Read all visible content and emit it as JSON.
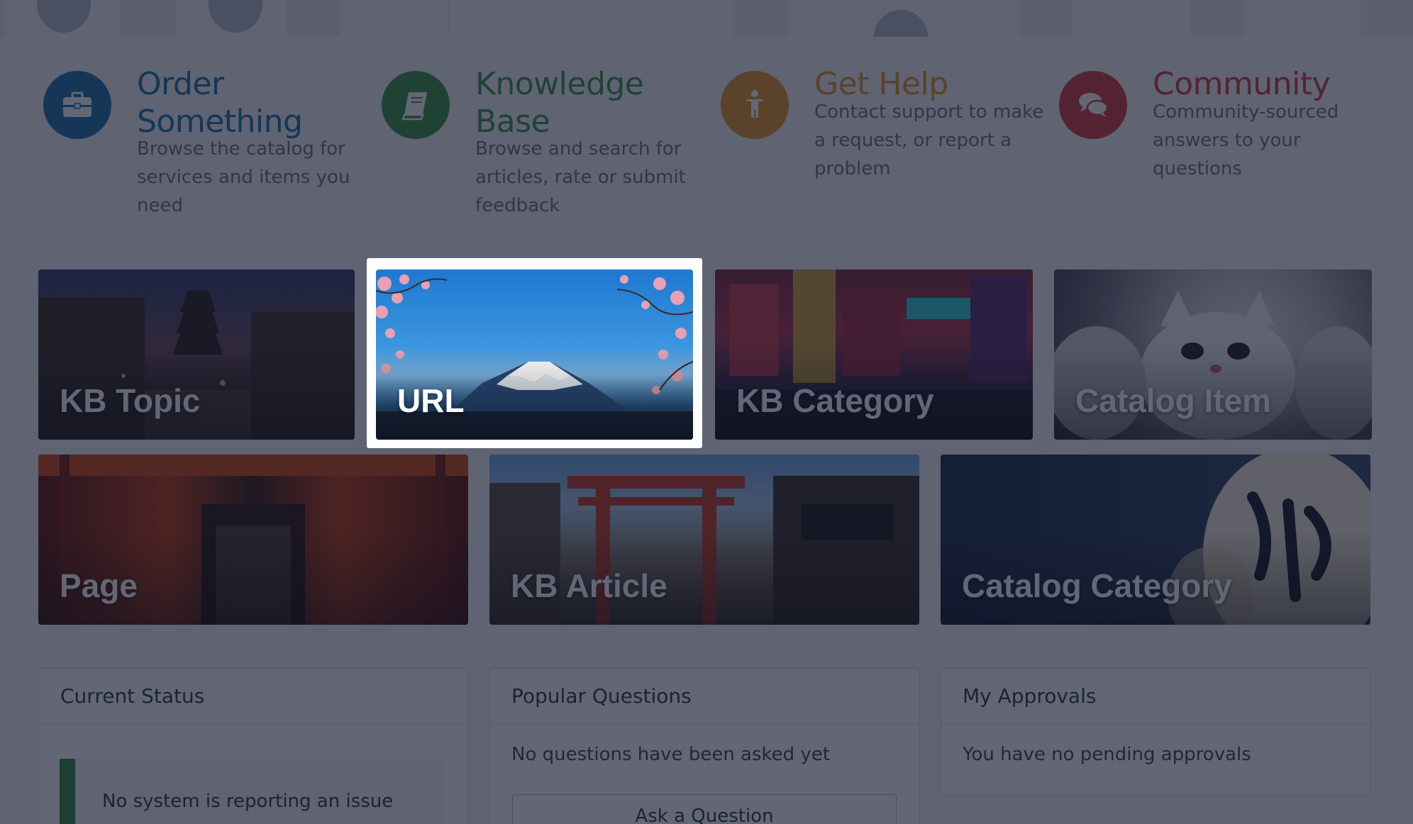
{
  "quick_links": [
    {
      "title": "Order Something",
      "description": "Browse the catalog for services and items you need",
      "color": "#1d6fa8",
      "icon": "briefcase-icon"
    },
    {
      "title": "Knowledge Base",
      "description": "Browse and search for articles, rate or submit feedback",
      "color": "#3b9245",
      "icon": "book-icon"
    },
    {
      "title": "Get Help",
      "description": "Contact support to make a request, or report a problem",
      "color": "#e69327",
      "icon": "person-icon"
    },
    {
      "title": "Community",
      "description": "Community-sourced answers to your questions",
      "color": "#d33a3a",
      "icon": "chat-bubbles-icon"
    }
  ],
  "tiles_row1": [
    {
      "label": "KB Topic"
    },
    {
      "label": "URL"
    },
    {
      "label": "KB Category"
    },
    {
      "label": "Catalog Item"
    }
  ],
  "tiles_row2": [
    {
      "label": "Page"
    },
    {
      "label": "KB Article"
    },
    {
      "label": "Catalog Category"
    }
  ],
  "highlighted_tile": "URL",
  "widgets": {
    "current_status": {
      "title": "Current Status",
      "message": "No system is reporting an issue"
    },
    "popular_questions": {
      "title": "Popular Questions",
      "message": "No questions have been asked yet",
      "button": "Ask a Question"
    },
    "my_approvals": {
      "title": "My Approvals",
      "message": "You have no pending approvals"
    }
  }
}
